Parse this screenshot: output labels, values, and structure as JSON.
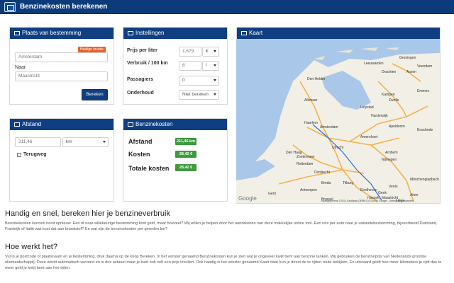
{
  "app": {
    "title": "Benzinekosten berekenen"
  },
  "panels": {
    "destination": {
      "title": "Plaats van bestemming",
      "from_value": "Amsterdam",
      "current_location_badge": "Huidige locatie",
      "to_label": "Naar",
      "to_value": "Maastricht",
      "calculate_button": "Bereken"
    },
    "settings": {
      "title": "Instellingen",
      "price_label": "Prijs per liter",
      "price_value": "1,679",
      "price_unit": "€",
      "usage_label": "Verbruik / 100 km",
      "usage_value": "8",
      "usage_unit": "l",
      "passengers_label": "Passagiers",
      "passengers_value": "0",
      "maintenance_label": "Onderhoud",
      "maintenance_value": "Niet bereken"
    },
    "distance": {
      "title": "Afstand",
      "value": "211,46",
      "unit": "km",
      "return_label": "Terugweg"
    },
    "costs": {
      "title": "Benzinekosten",
      "rows": [
        {
          "label": "Afstand",
          "value": "211,46 km"
        },
        {
          "label": "Kosten",
          "value": "28,42 €"
        },
        {
          "label": "Totale kosten",
          "value": "28,42 €"
        }
      ]
    },
    "map": {
      "title": "Kaart",
      "google": "Google",
      "copyright": "Kaartgegevens ©2014 GeoBasis-DE/BKG (©2009), Google - Gebruiksvoorwaarden",
      "cities": [
        "Groningen",
        "Leeuwarden",
        "Assen",
        "Drachten",
        "Emmen",
        "Zwolle",
        "Alkmaar",
        "Lelystad",
        "Haarlem",
        "Amsterdam",
        "Amersfoort",
        "Apeldoorn",
        "Enschede",
        "Den Haag",
        "Utrecht",
        "Arnhem",
        "Rotterdam",
        "Nijmegen",
        "Dordrecht",
        "Breda",
        "Tilburg",
        "Eindhoven",
        "Venlo",
        "Antwerpen",
        "Gent",
        "Hasselt",
        "Maastricht",
        "Brussel",
        "Liège",
        "Genk",
        "Aken",
        "Mönchengladbach",
        "Zoetermeer",
        "Veendam",
        "Harderwijk",
        "Den Helder",
        "Kampen"
      ]
    }
  },
  "content": {
    "heading1": "Handig en snel, bereken hier je benzineverbruik",
    "intro": "Benzinekosten kunnen nooit opnieuw. Een rit naar willekeurige bestemming kost geld, maar hoeveel? Wij willen je helpen door het aanrekenen van deze makkelijke online tool. Een reis per auto naar je vakantiebestemming, bijvoorbeeld Duitsland, Frankrijk of Italië wat kost dat aan brandstof? En wat zijn de benzinekosten per gereden km?",
    "heading2": "Hoe werkt het?",
    "howto": "Vul in je postcode of plaatsnaam en je bestemming, druk daarna op de knop Bereken. In het venster genaamd Benzinekosten kun je zien wat je ongeveer kwijt bent aan benzine tanken. Wij gebruiken de benzineprijs van Nederlands grootste oliemaatschappij. Deze wordt automatisch ververst en is dus actueel maar je kunt ook zelf een prijs invullen. Ook handig is het venster genaamd Kaart daar kun je direct de te rijden route bekijken. En uiteraard geldt hoe meer kilometers je rijdt des te meer geld je kwijt bent aan het rijden."
  },
  "colors": {
    "navbar": "#0b3b7a",
    "panel_header": "#0f3f82",
    "result_green": "#3d9a3d",
    "badge_orange": "#e8622a"
  },
  "icons": [
    "home-icon",
    "pin-icon",
    "sliders-icon",
    "road-icon",
    "fuel-icon",
    "map-icon"
  ]
}
